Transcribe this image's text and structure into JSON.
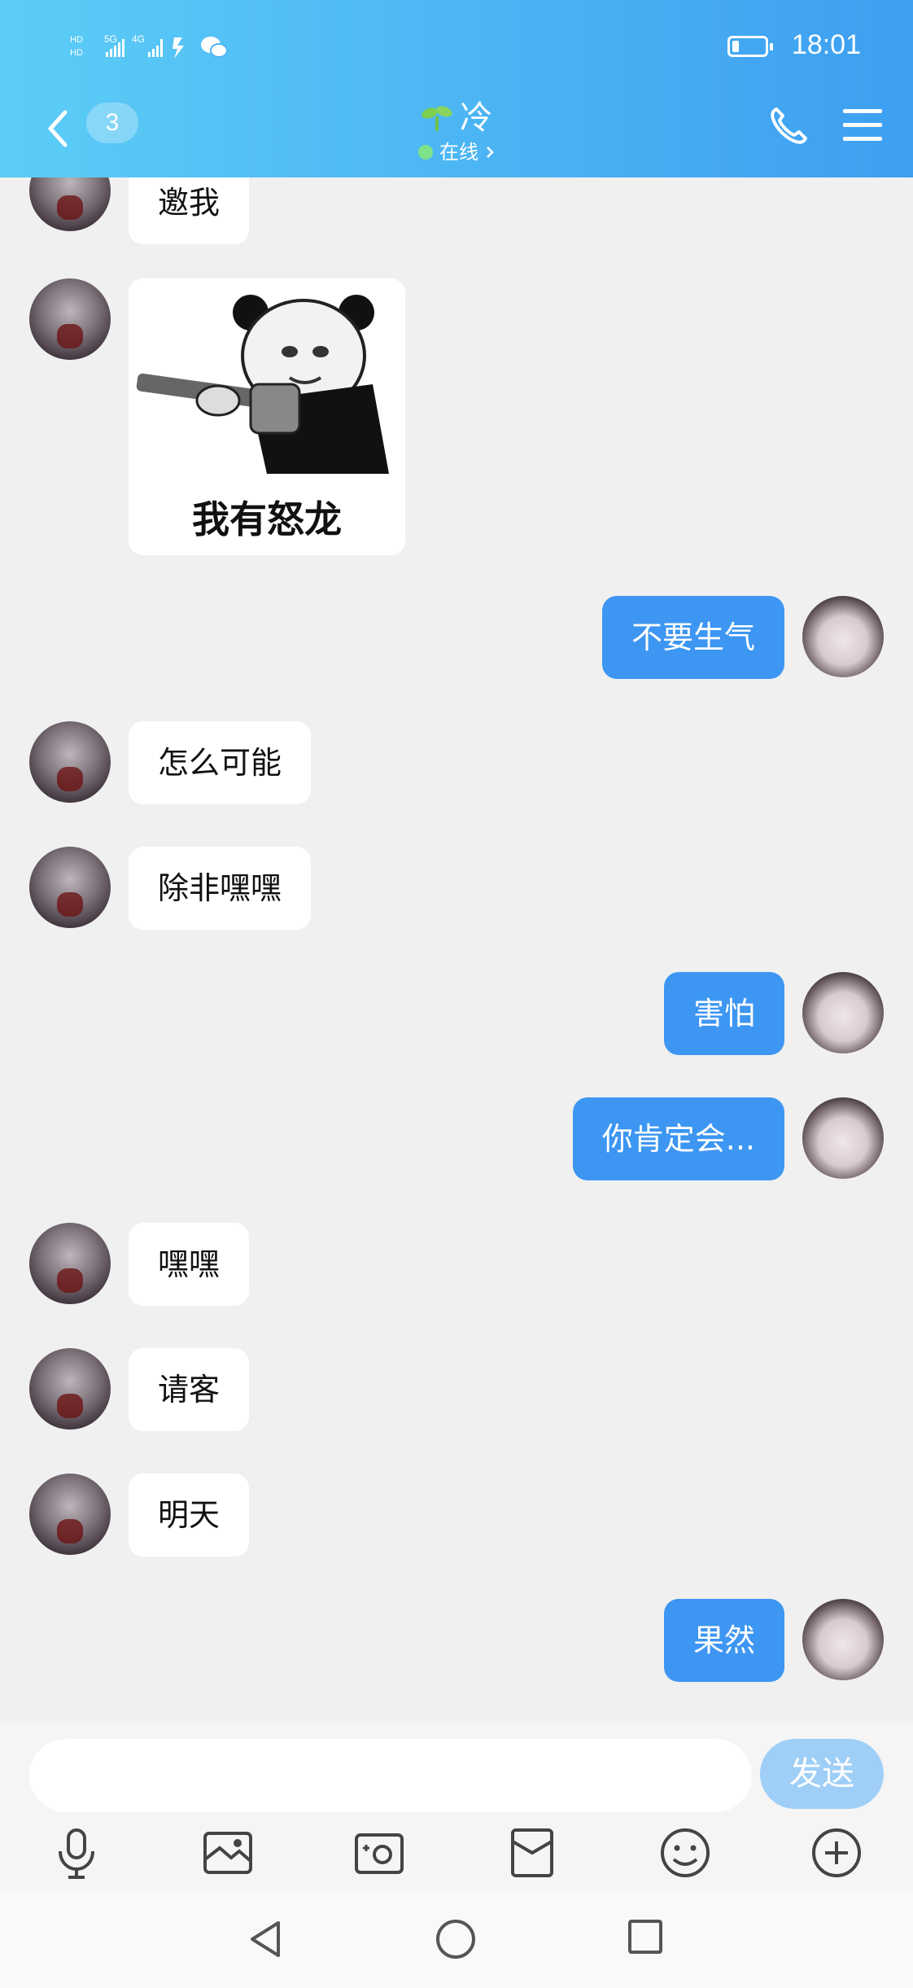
{
  "status_bar": {
    "time": "18:01",
    "network_labels": [
      "HD",
      "5G",
      "4G"
    ]
  },
  "header": {
    "unread_count": "3",
    "contact_name": "冷",
    "presence": "在线"
  },
  "messages": [
    {
      "side": "in",
      "type": "text",
      "text": "邀我"
    },
    {
      "side": "in",
      "type": "sticker",
      "caption": "我有怒龙"
    },
    {
      "side": "out",
      "type": "text",
      "text": "不要生气"
    },
    {
      "side": "in",
      "type": "text",
      "text": "怎么可能"
    },
    {
      "side": "in",
      "type": "text",
      "text": "除非嘿嘿"
    },
    {
      "side": "out",
      "type": "text",
      "text": "害怕"
    },
    {
      "side": "out",
      "type": "text",
      "text": "你肯定会..."
    },
    {
      "side": "in",
      "type": "text",
      "text": "嘿嘿"
    },
    {
      "side": "in",
      "type": "text",
      "text": "请客"
    },
    {
      "side": "in",
      "type": "text",
      "text": "明天"
    },
    {
      "side": "out",
      "type": "text",
      "text": "果然"
    }
  ],
  "composer": {
    "input_value": "",
    "send_label": "发送"
  },
  "toolbar": [
    "microphone-icon",
    "image-icon",
    "camera-icon",
    "red-envelope-icon",
    "emoji-icon",
    "plus-icon"
  ],
  "system_nav": [
    "back-triangle-icon",
    "home-circle-icon",
    "recents-square-icon"
  ]
}
